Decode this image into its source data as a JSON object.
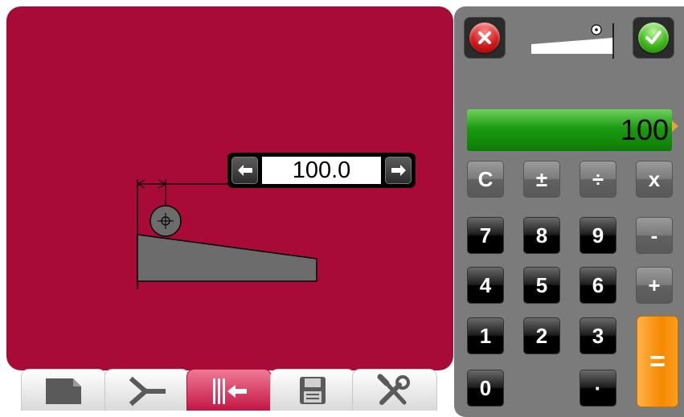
{
  "canvas": {
    "background": "#a80b37",
    "dimension_value": "100.0"
  },
  "tabs": [
    {
      "name": "new-file",
      "icon": "document-icon",
      "active": false
    },
    {
      "name": "bend-angle",
      "icon": "bend-angle-icon",
      "active": false
    },
    {
      "name": "backgauge",
      "icon": "backgauge-icon",
      "active": true
    },
    {
      "name": "save",
      "icon": "floppy-disk-icon",
      "active": false
    },
    {
      "name": "tools",
      "icon": "tools-icon",
      "active": false
    }
  ],
  "keypad": {
    "display_value": "100",
    "rows": [
      [
        "C",
        "±",
        "÷",
        "x"
      ],
      [
        "7",
        "8",
        "9",
        "-"
      ],
      [
        "4",
        "5",
        "6",
        "+"
      ],
      [
        "1",
        "2",
        "3"
      ],
      [
        "0",
        "",
        "·"
      ]
    ],
    "equals": "="
  },
  "colors": {
    "accent_red": "#a80b37",
    "display_green": "#1b9b11",
    "equals_orange": "#f58900"
  }
}
